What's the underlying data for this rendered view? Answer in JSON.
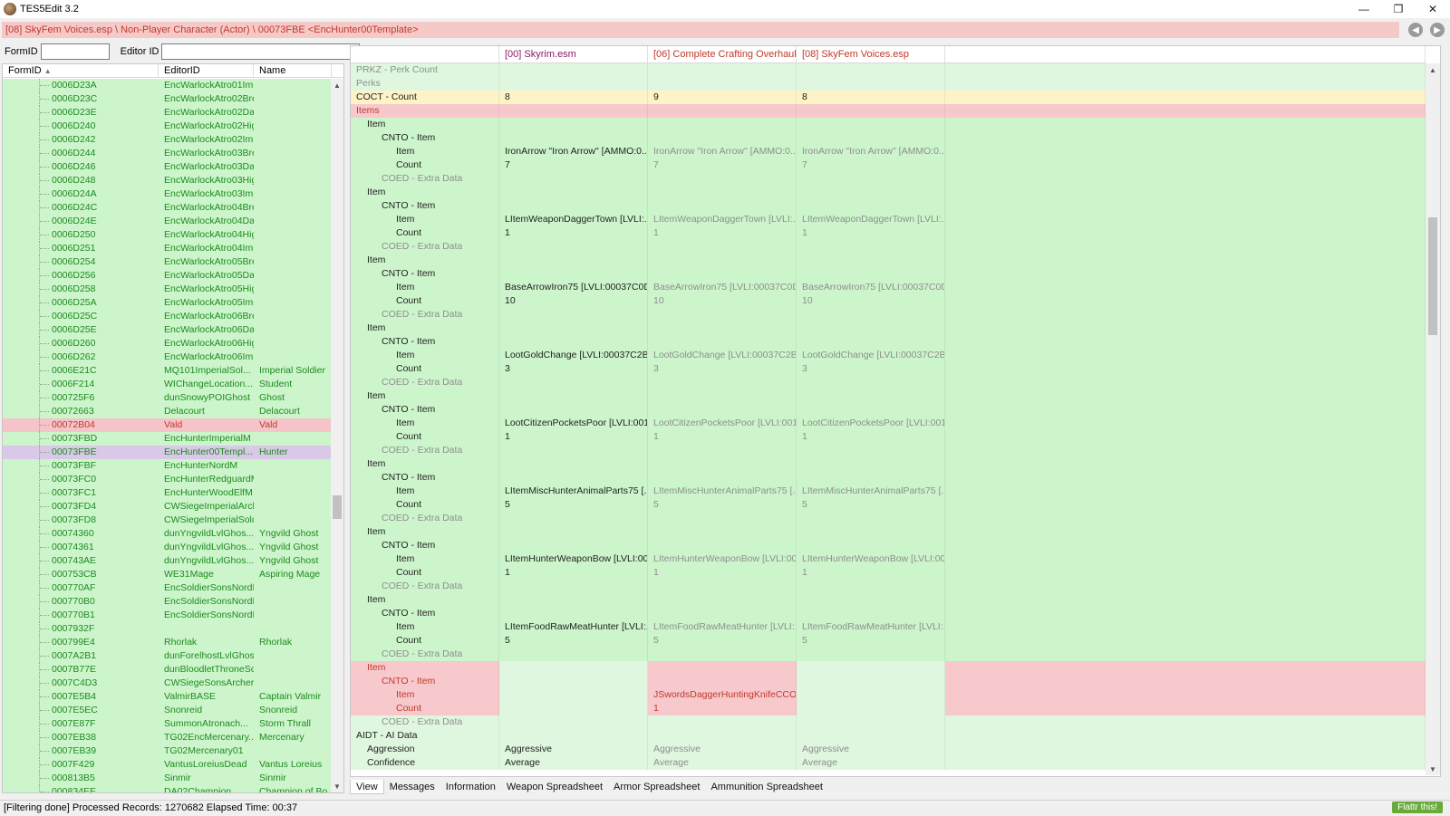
{
  "window": {
    "title": "TES5Edit 3.2",
    "min": "—",
    "max": "❐",
    "close": "✕"
  },
  "path": "[08] SkyFem Voices.esp \\ Non-Player Character (Actor) \\ 00073FBE <EncHunter00Template>",
  "filter": {
    "formid_label": "FormID",
    "formid_value": "",
    "editorid_label": "Editor ID",
    "editorid_value": ""
  },
  "left_headers": {
    "formid": "FormID",
    "editorid": "EditorID",
    "name": "Name"
  },
  "left_rows": [
    [
      "0006D23A",
      "EncWarlockAtro01ImperialM",
      ""
    ],
    [
      "0006D23C",
      "EncWarlockAtro02BretonM",
      ""
    ],
    [
      "0006D23E",
      "EncWarlockAtro02DarkElfM",
      ""
    ],
    [
      "0006D240",
      "EncWarlockAtro02HighElfM",
      ""
    ],
    [
      "0006D242",
      "EncWarlockAtro02ImperialM",
      ""
    ],
    [
      "0006D244",
      "EncWarlockAtro03BretonM",
      ""
    ],
    [
      "0006D246",
      "EncWarlockAtro03DarkElfM",
      ""
    ],
    [
      "0006D248",
      "EncWarlockAtro03HighElfM",
      ""
    ],
    [
      "0006D24A",
      "EncWarlockAtro03ImperialM",
      ""
    ],
    [
      "0006D24C",
      "EncWarlockAtro04BretonM",
      ""
    ],
    [
      "0006D24E",
      "EncWarlockAtro04DarkElfM",
      ""
    ],
    [
      "0006D250",
      "EncWarlockAtro04HighElfM",
      ""
    ],
    [
      "0006D251",
      "EncWarlockAtro04ImperialM",
      ""
    ],
    [
      "0006D254",
      "EncWarlockAtro05BretonM",
      ""
    ],
    [
      "0006D256",
      "EncWarlockAtro05DarkElfM",
      ""
    ],
    [
      "0006D258",
      "EncWarlockAtro05HighElfM",
      ""
    ],
    [
      "0006D25A",
      "EncWarlockAtro05ImperialM",
      ""
    ],
    [
      "0006D25C",
      "EncWarlockAtro06BretonM",
      ""
    ],
    [
      "0006D25E",
      "EncWarlockAtro06DarkElfM",
      ""
    ],
    [
      "0006D260",
      "EncWarlockAtro06HighElfM",
      ""
    ],
    [
      "0006D262",
      "EncWarlockAtro06ImperialM",
      ""
    ],
    [
      "0006E21C",
      "MQ101ImperialSol...",
      "Imperial Soldier"
    ],
    [
      "0006F214",
      "WIChangeLocation...",
      "Student"
    ],
    [
      "000725F6",
      "dunSnowyPOIGhost",
      "Ghost"
    ],
    [
      "00072663",
      "Delacourt",
      "Delacourt"
    ],
    [
      "00072B04",
      "Vald",
      "Vald"
    ],
    [
      "00073FBD",
      "EncHunterImperialM",
      ""
    ],
    [
      "00073FBE",
      "EncHunter00Templ...",
      "Hunter"
    ],
    [
      "00073FBF",
      "EncHunterNordM",
      ""
    ],
    [
      "00073FC0",
      "EncHunterRedguardM",
      ""
    ],
    [
      "00073FC1",
      "EncHunterWoodElfM",
      ""
    ],
    [
      "00073FD4",
      "CWSiegeImperialArcherHold",
      ""
    ],
    [
      "00073FD8",
      "CWSiegeImperialSoldierHold",
      ""
    ],
    [
      "00074360",
      "dunYngvildLvlGhos...",
      "Yngvild Ghost"
    ],
    [
      "00074361",
      "dunYngvildLvlGhos...",
      "Yngvild Ghost"
    ],
    [
      "000743AE",
      "dunYngvildLvlGhos...",
      "Yngvild Ghost"
    ],
    [
      "000753CB",
      "WE31Mage",
      "Aspiring Mage"
    ],
    [
      "000770AF",
      "EncSoldierSonsNordM04MaleNord",
      ""
    ],
    [
      "000770B0",
      "EncSoldierSonsNordM05MaleNord",
      ""
    ],
    [
      "000770B1",
      "EncSoldierSonsNordM06MaleNord",
      ""
    ],
    [
      "0007932F",
      "",
      ""
    ],
    [
      "000799E4",
      "Rhorlak",
      "Rhorlak"
    ],
    [
      "0007A2B1",
      "dunForelhostLvlGhostMelee1HMale",
      ""
    ],
    [
      "0007B77E",
      "dunBloodletThroneSceneVampire",
      ""
    ],
    [
      "0007C4D3",
      "CWSiegeSonsArcherHold",
      ""
    ],
    [
      "0007E5B4",
      "ValmirBASE",
      "Captain Valmir"
    ],
    [
      "0007E5EC",
      "Snonreid",
      "Snonreid"
    ],
    [
      "0007E87F",
      "SummonAtronach...",
      "Storm Thrall"
    ],
    [
      "0007EB38",
      "TG02EncMercenary...",
      "Mercenary"
    ],
    [
      "0007EB39",
      "TG02Mercenary01",
      ""
    ],
    [
      "0007F429",
      "VantusLoreiusDead",
      "Vantus Loreius"
    ],
    [
      "000813B5",
      "Sinmir",
      "Sinmir"
    ],
    [
      "000834EE",
      "DA02Champion",
      "Champion of Bo..."
    ]
  ],
  "left_special": {
    "red_index": 25,
    "selected_index": 27
  },
  "right_headers": {
    "c0": "",
    "c1": "[00] Skyrim.esm",
    "c2": "[06] Complete Crafting Overhaul_...",
    "c3": "[08] SkyFem Voices.esp",
    "c4": ""
  },
  "header_colors": {
    "c1": "#8b1a6b",
    "c2": "#c0392b",
    "c3": "#c0392b"
  },
  "right_rows": [
    {
      "l": "PRKZ - Perk Count",
      "i": 0,
      "bg": "lightgreen",
      "lc": "gray",
      "v": [
        "",
        "",
        ""
      ],
      "vc": "gray"
    },
    {
      "l": "Perks",
      "i": 0,
      "bg": "lightgreen",
      "lc": "gray",
      "v": [
        "",
        "",
        ""
      ],
      "vc": "gray"
    },
    {
      "l": "COCT - Count",
      "i": 0,
      "bg": "yellow",
      "lc": "dark",
      "v": [
        "8",
        "9",
        "8"
      ],
      "vc": "dark"
    },
    {
      "l": "Items",
      "i": 0,
      "bg": "red",
      "lc": "red",
      "v": [
        "",
        "",
        ""
      ],
      "vc": "red"
    },
    {
      "l": "Item",
      "i": 1,
      "bg": "green",
      "lc": "dark",
      "v": [
        "",
        "",
        ""
      ],
      "vc": "dark"
    },
    {
      "l": "CNTO - Item",
      "i": 2,
      "bg": "green",
      "lc": "dark",
      "v": [
        "",
        "",
        ""
      ],
      "vc": "dark"
    },
    {
      "l": "Item",
      "i": 3,
      "bg": "green",
      "lc": "dark",
      "v": [
        "IronArrow \"Iron Arrow\" [AMMO:0...",
        "IronArrow \"Iron Arrow\" [AMMO:0...",
        "IronArrow \"Iron Arrow\" [AMMO:0..."
      ],
      "vc": "mix"
    },
    {
      "l": "Count",
      "i": 3,
      "bg": "green",
      "lc": "dark",
      "v": [
        "7",
        "7",
        "7"
      ],
      "vc": "mix"
    },
    {
      "l": "COED - Extra Data",
      "i": 2,
      "bg": "green",
      "lc": "gray",
      "v": [
        "",
        "",
        ""
      ],
      "vc": "gray"
    },
    {
      "l": "Item",
      "i": 1,
      "bg": "green",
      "lc": "dark",
      "v": [
        "",
        "",
        ""
      ],
      "vc": "dark"
    },
    {
      "l": "CNTO - Item",
      "i": 2,
      "bg": "green",
      "lc": "dark",
      "v": [
        "",
        "",
        ""
      ],
      "vc": "dark"
    },
    {
      "l": "Item",
      "i": 3,
      "bg": "green",
      "lc": "dark",
      "v": [
        "LItemWeaponDaggerTown [LVLI:...",
        "LItemWeaponDaggerTown [LVLI:...",
        "LItemWeaponDaggerTown [LVLI:..."
      ],
      "vc": "mix"
    },
    {
      "l": "Count",
      "i": 3,
      "bg": "green",
      "lc": "dark",
      "v": [
        "1",
        "1",
        "1"
      ],
      "vc": "mix"
    },
    {
      "l": "COED - Extra Data",
      "i": 2,
      "bg": "green",
      "lc": "gray",
      "v": [
        "",
        "",
        ""
      ],
      "vc": "gray"
    },
    {
      "l": "Item",
      "i": 1,
      "bg": "green",
      "lc": "dark",
      "v": [
        "",
        "",
        ""
      ],
      "vc": "dark"
    },
    {
      "l": "CNTO - Item",
      "i": 2,
      "bg": "green",
      "lc": "dark",
      "v": [
        "",
        "",
        ""
      ],
      "vc": "dark"
    },
    {
      "l": "Item",
      "i": 3,
      "bg": "green",
      "lc": "dark",
      "v": [
        "BaseArrowIron75 [LVLI:00037C0D]",
        "BaseArrowIron75 [LVLI:00037C0D]",
        "BaseArrowIron75 [LVLI:00037C0D]"
      ],
      "vc": "mix"
    },
    {
      "l": "Count",
      "i": 3,
      "bg": "green",
      "lc": "dark",
      "v": [
        "10",
        "10",
        "10"
      ],
      "vc": "mix"
    },
    {
      "l": "COED - Extra Data",
      "i": 2,
      "bg": "green",
      "lc": "gray",
      "v": [
        "",
        "",
        ""
      ],
      "vc": "gray"
    },
    {
      "l": "Item",
      "i": 1,
      "bg": "green",
      "lc": "dark",
      "v": [
        "",
        "",
        ""
      ],
      "vc": "dark"
    },
    {
      "l": "CNTO - Item",
      "i": 2,
      "bg": "green",
      "lc": "dark",
      "v": [
        "",
        "",
        ""
      ],
      "vc": "dark"
    },
    {
      "l": "Item",
      "i": 3,
      "bg": "green",
      "lc": "dark",
      "v": [
        "LootGoldChange [LVLI:00037C2B]",
        "LootGoldChange [LVLI:00037C2B]",
        "LootGoldChange [LVLI:00037C2B]"
      ],
      "vc": "mix"
    },
    {
      "l": "Count",
      "i": 3,
      "bg": "green",
      "lc": "dark",
      "v": [
        "3",
        "3",
        "3"
      ],
      "vc": "mix"
    },
    {
      "l": "COED - Extra Data",
      "i": 2,
      "bg": "green",
      "lc": "gray",
      "v": [
        "",
        "",
        ""
      ],
      "vc": "gray"
    },
    {
      "l": "Item",
      "i": 1,
      "bg": "green",
      "lc": "dark",
      "v": [
        "",
        "",
        ""
      ],
      "vc": "dark"
    },
    {
      "l": "CNTO - Item",
      "i": 2,
      "bg": "green",
      "lc": "dark",
      "v": [
        "",
        "",
        ""
      ],
      "vc": "dark"
    },
    {
      "l": "Item",
      "i": 3,
      "bg": "green",
      "lc": "dark",
      "v": [
        "LootCitizenPocketsPoor [LVLI:001...",
        "LootCitizenPocketsPoor [LVLI:001...",
        "LootCitizenPocketsPoor [LVLI:001..."
      ],
      "vc": "mix"
    },
    {
      "l": "Count",
      "i": 3,
      "bg": "green",
      "lc": "dark",
      "v": [
        "1",
        "1",
        "1"
      ],
      "vc": "mix"
    },
    {
      "l": "COED - Extra Data",
      "i": 2,
      "bg": "green",
      "lc": "gray",
      "v": [
        "",
        "",
        ""
      ],
      "vc": "gray"
    },
    {
      "l": "Item",
      "i": 1,
      "bg": "green",
      "lc": "dark",
      "v": [
        "",
        "",
        ""
      ],
      "vc": "dark"
    },
    {
      "l": "CNTO - Item",
      "i": 2,
      "bg": "green",
      "lc": "dark",
      "v": [
        "",
        "",
        ""
      ],
      "vc": "dark"
    },
    {
      "l": "Item",
      "i": 3,
      "bg": "green",
      "lc": "dark",
      "v": [
        "LItemMiscHunterAnimalParts75 [...",
        "LItemMiscHunterAnimalParts75 [...",
        "LItemMiscHunterAnimalParts75 [..."
      ],
      "vc": "mix"
    },
    {
      "l": "Count",
      "i": 3,
      "bg": "green",
      "lc": "dark",
      "v": [
        "5",
        "5",
        "5"
      ],
      "vc": "mix"
    },
    {
      "l": "COED - Extra Data",
      "i": 2,
      "bg": "green",
      "lc": "gray",
      "v": [
        "",
        "",
        ""
      ],
      "vc": "gray"
    },
    {
      "l": "Item",
      "i": 1,
      "bg": "green",
      "lc": "dark",
      "v": [
        "",
        "",
        ""
      ],
      "vc": "dark"
    },
    {
      "l": "CNTO - Item",
      "i": 2,
      "bg": "green",
      "lc": "dark",
      "v": [
        "",
        "",
        ""
      ],
      "vc": "dark"
    },
    {
      "l": "Item",
      "i": 3,
      "bg": "green",
      "lc": "dark",
      "v": [
        "LItemHunterWeaponBow [LVLI:00...",
        "LItemHunterWeaponBow [LVLI:00...",
        "LItemHunterWeaponBow [LVLI:00..."
      ],
      "vc": "mix"
    },
    {
      "l": "Count",
      "i": 3,
      "bg": "green",
      "lc": "dark",
      "v": [
        "1",
        "1",
        "1"
      ],
      "vc": "mix"
    },
    {
      "l": "COED - Extra Data",
      "i": 2,
      "bg": "green",
      "lc": "gray",
      "v": [
        "",
        "",
        ""
      ],
      "vc": "gray"
    },
    {
      "l": "Item",
      "i": 1,
      "bg": "green",
      "lc": "dark",
      "v": [
        "",
        "",
        ""
      ],
      "vc": "dark"
    },
    {
      "l": "CNTO - Item",
      "i": 2,
      "bg": "green",
      "lc": "dark",
      "v": [
        "",
        "",
        ""
      ],
      "vc": "dark"
    },
    {
      "l": "Item",
      "i": 3,
      "bg": "green",
      "lc": "dark",
      "v": [
        "LItemFoodRawMeatHunter [LVLI:...",
        "LItemFoodRawMeatHunter [LVLI:...",
        "LItemFoodRawMeatHunter [LVLI:..."
      ],
      "vc": "mix"
    },
    {
      "l": "Count",
      "i": 3,
      "bg": "green",
      "lc": "dark",
      "v": [
        "5",
        "5",
        "5"
      ],
      "vc": "mix"
    },
    {
      "l": "COED - Extra Data",
      "i": 2,
      "bg": "green",
      "lc": "gray",
      "v": [
        "",
        "",
        ""
      ],
      "vc": "gray"
    },
    {
      "l": "Item",
      "i": 1,
      "bg": "red",
      "lc": "red",
      "v": [
        "",
        "",
        ""
      ],
      "vc": "red",
      "only": 1
    },
    {
      "l": "CNTO - Item",
      "i": 2,
      "bg": "red",
      "lc": "red",
      "v": [
        "",
        "",
        ""
      ],
      "vc": "red",
      "only": 1
    },
    {
      "l": "Item",
      "i": 3,
      "bg": "red",
      "lc": "red",
      "v": [
        "",
        "JSwordsDaggerHuntingKnifeCCO...",
        ""
      ],
      "vc": "red",
      "only": 1
    },
    {
      "l": "Count",
      "i": 3,
      "bg": "red",
      "lc": "red",
      "v": [
        "",
        "1",
        ""
      ],
      "vc": "red",
      "only": 1
    },
    {
      "l": "COED - Extra Data",
      "i": 2,
      "bg": "lightgreen",
      "lc": "gray",
      "v": [
        "",
        "",
        ""
      ],
      "vc": "gray"
    },
    {
      "l": "AIDT - AI Data",
      "i": 0,
      "bg": "lightgreen",
      "lc": "dark",
      "v": [
        "",
        "",
        ""
      ],
      "vc": "dark"
    },
    {
      "l": "Aggression",
      "i": 1,
      "bg": "lightgreen",
      "lc": "dark",
      "v": [
        "Aggressive",
        "Aggressive",
        "Aggressive"
      ],
      "vc": "mix"
    },
    {
      "l": "Confidence",
      "i": 1,
      "bg": "lightgreen",
      "lc": "dark",
      "v": [
        "Average",
        "Average",
        "Average"
      ],
      "vc": "mix"
    }
  ],
  "tabs": [
    "View",
    "Messages",
    "Information",
    "Weapon Spreadsheet",
    "Armor Spreadsheet",
    "Ammunition Spreadsheet"
  ],
  "status": "[Filtering done]  Processed Records: 1270682 Elapsed Time: 00:37",
  "flattr": "Flattr  this!",
  "icons": {
    "back": "arrow-left-icon",
    "forward": "arrow-right-icon",
    "sort": "sort-up-icon"
  }
}
